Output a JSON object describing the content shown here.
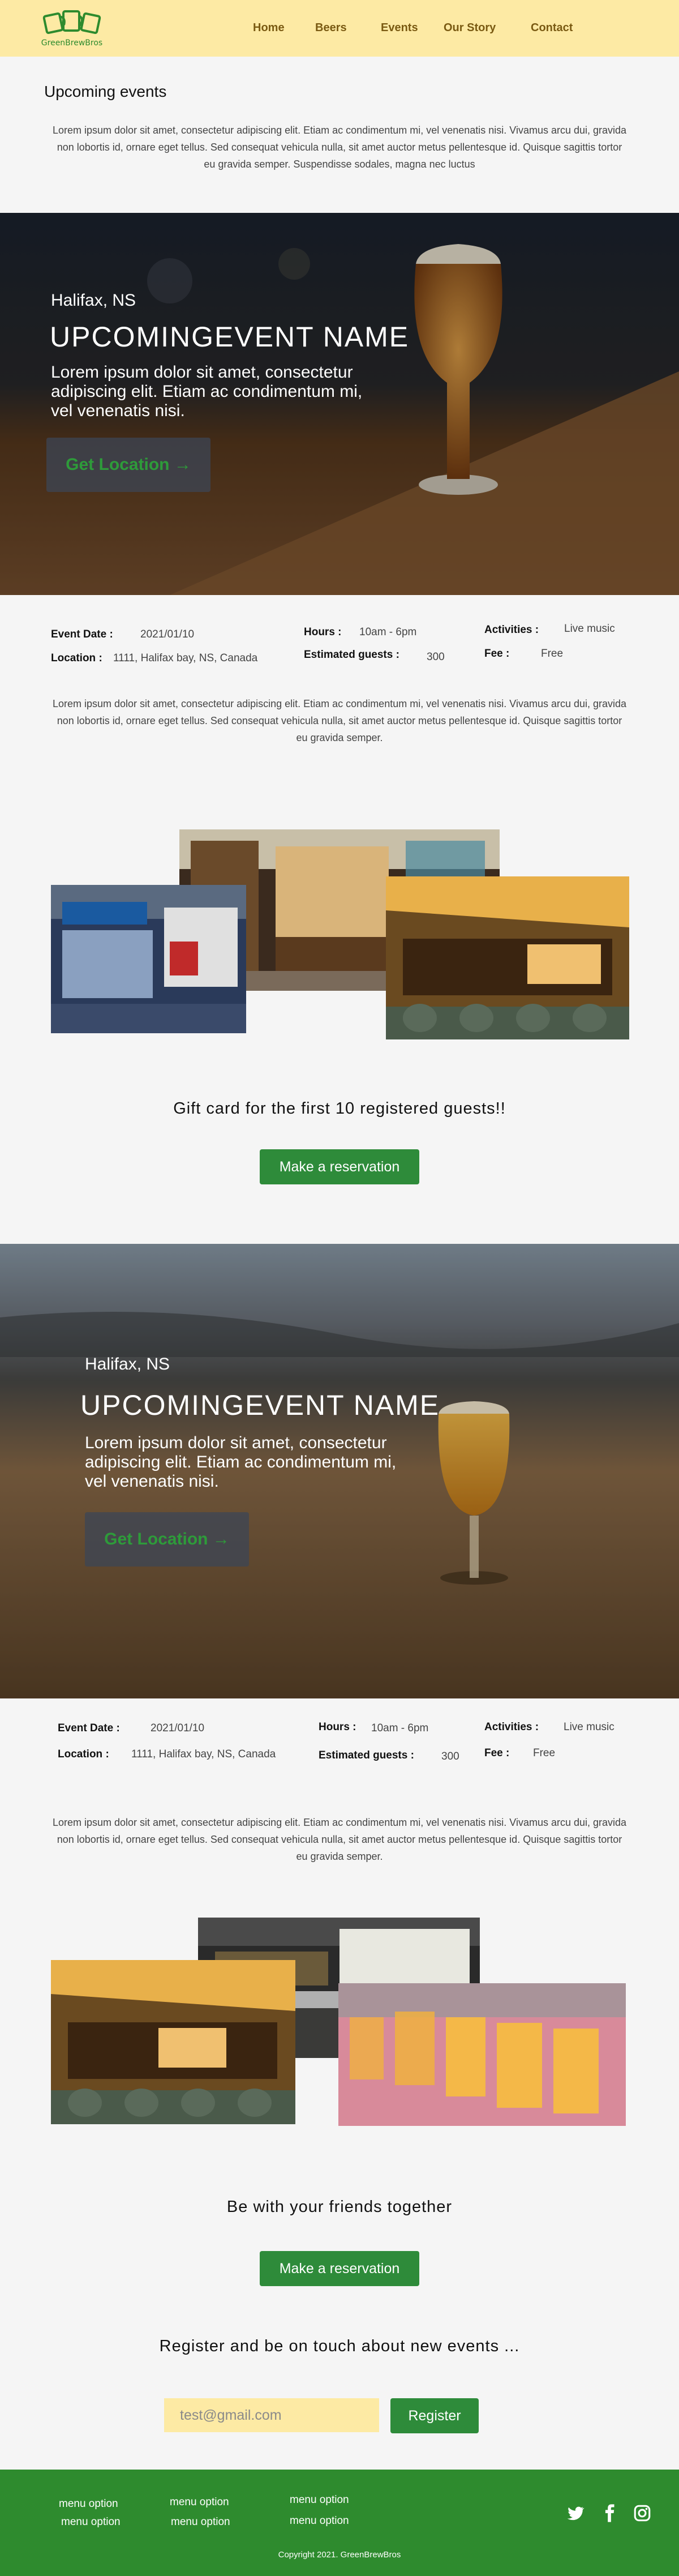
{
  "brand": {
    "logo_text": "GreenBrewBros"
  },
  "nav": {
    "links": [
      "Home",
      "Beers",
      "Events",
      "Our Story",
      "Contact"
    ]
  },
  "intro": {
    "title": "Upcoming events",
    "text": "Lorem ipsum dolor sit amet, consectetur adipiscing elit. Etiam ac condimentum mi, vel venenatis nisi. Vivamus arcu dui, gravida non lobortis id, ornare eget tellus. Sed consequat vehicula nulla, sit amet auctor metus pellentesque id. Quisque sagittis tortor eu gravida semper. Suspendisse sodales, magna nec luctus"
  },
  "events": [
    {
      "city": "Halifax, NS",
      "name": "UPCOMINGEVENT NAME",
      "description": "Lorem ipsum dolor sit amet, consectetur adipiscing elit. Etiam ac condimentum mi, vel venenatis nisi.",
      "button": "Get Location →",
      "labels": {
        "date": "Event Date :",
        "location": "Location :",
        "hours": "Hours :",
        "guests": "Estimated guests :",
        "activities": "Activities :",
        "fee": "Fee :"
      },
      "values": {
        "date": "2021/01/10",
        "location": "1111, Halifax bay, NS, Canada",
        "hours": "10am - 6pm",
        "guests": "300",
        "activities": "Live music",
        "fee": "Free"
      },
      "text": "Lorem ipsum dolor sit amet, consectetur adipiscing elit. Etiam ac condimentum mi, vel venenatis nisi. Vivamus arcu dui, gravida non lobortis id, ornare eget tellus. Sed consequat vehicula nulla, sit amet auctor metus pellentesque id. Quisque sagittis tortor eu gravida semper.",
      "cta_text": "Gift card for the first 10 registered guests!!",
      "cta_button": "Make a reservation"
    },
    {
      "city": "Halifax, NS",
      "name": "UPCOMINGEVENT NAME",
      "description": "Lorem ipsum dolor sit amet, consectetur adipiscing elit. Etiam ac condimentum mi, vel venenatis nisi.",
      "button": "Get Location →",
      "labels": {
        "date": "Event Date :",
        "location": "Location :",
        "hours": "Hours :",
        "guests": "Estimated guests :",
        "activities": "Activities :",
        "fee": "Fee :"
      },
      "values": {
        "date": "2021/01/10",
        "location": "1111, Halifax bay, NS, Canada",
        "hours": "10am - 6pm",
        "guests": "300",
        "activities": "Live music",
        "fee": "Free"
      },
      "text": "Lorem ipsum dolor sit amet, consectetur adipiscing elit. Etiam ac condimentum mi, vel venenatis nisi. Vivamus arcu dui, gravida non lobortis id, ornare eget tellus. Sed consequat vehicula nulla, sit amet auctor metus pellentesque id. Quisque sagittis tortor eu gravida semper.",
      "cta_text": "Be with your friends together",
      "cta_button": "Make a reservation"
    }
  ],
  "register": {
    "text": "Register and be on touch about new events ...",
    "placeholder": "test@gmail.com",
    "button": "Register"
  },
  "footer": {
    "menu": [
      "menu option",
      "menu option",
      "menu option",
      "menu option",
      "menu option",
      "menu option"
    ],
    "copyright": "Copyright 2021. GreenBrewBros",
    "social": [
      "twitter-icon",
      "facebook-icon",
      "instagram-icon"
    ]
  },
  "colors": {
    "nav_bg": "#fdeaa4",
    "accent_green": "#2e8b2e",
    "nav_text": "#7a5a12"
  }
}
